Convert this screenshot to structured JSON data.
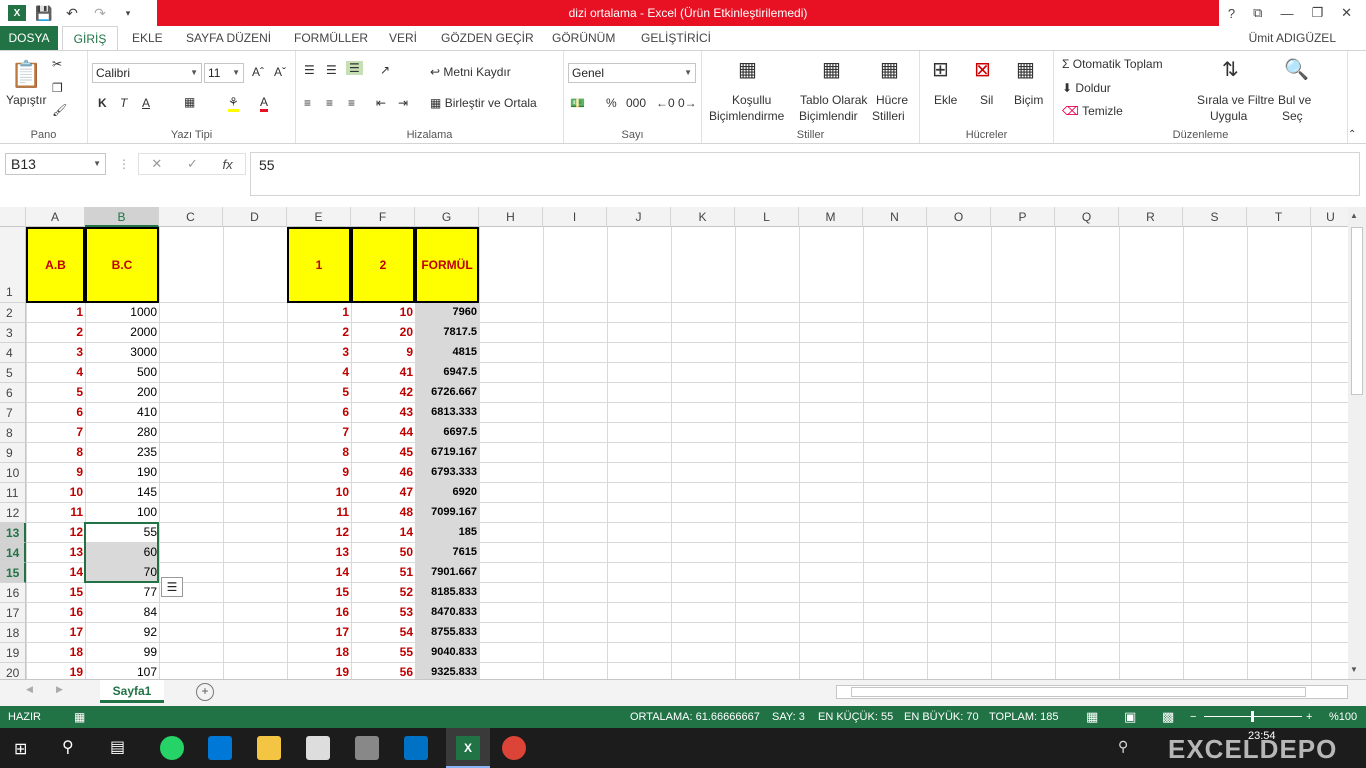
{
  "window": {
    "title": "dizi ortalama -  Excel (Ürün Etkinleştirilemedi)",
    "help": "?",
    "restore": "⧉",
    "minimize": "—",
    "maximize": "❐",
    "close": "✕"
  },
  "tabs": [
    "DOSYA",
    "GİRİŞ",
    "EKLE",
    "SAYFA DÜZENİ",
    "FORMÜLLER",
    "VERİ",
    "GÖZDEN GEÇİR",
    "GÖRÜNÜM",
    "GELİŞTİRİCİ"
  ],
  "user": "Ümit ADIGÜZEL",
  "ribbon": {
    "clipboard": {
      "paste": "Yapıştır",
      "label": "Pano"
    },
    "font": {
      "name": "Calibri",
      "size": "11",
      "label": "Yazı Tipi",
      "bold": "K",
      "italic": "T",
      "underline": "A",
      "color": "A"
    },
    "align": {
      "wrap": "Metni Kaydır",
      "merge": "Birleştir ve Ortala",
      "label": "Hizalama"
    },
    "number": {
      "format": "Genel",
      "percent": "%",
      "comma": "000",
      "label": "Sayı"
    },
    "styles": {
      "cond": "Koşullu",
      "cond2": "Biçimlendirme",
      "table": "Tablo Olarak",
      "table2": "Biçimlendir",
      "cell": "Hücre",
      "cell2": "Stilleri",
      "label": "Stiller"
    },
    "cells": {
      "insert": "Ekle",
      "delete": "Sil",
      "format": "Biçim",
      "label": "Hücreler"
    },
    "editing": {
      "autosum": "Otomatik Toplam",
      "fill": "Doldur",
      "clear": "Temizle",
      "sort": "Sırala ve Filtre",
      "sort2": "Uygula",
      "find": "Bul ve",
      "find2": "Seç",
      "label": "Düzenleme"
    }
  },
  "namebox": "B13",
  "fx": "fx",
  "formula": "55",
  "columns": [
    "A",
    "B",
    "C",
    "D",
    "E",
    "F",
    "G",
    "H",
    "I",
    "J",
    "K",
    "L",
    "M",
    "N",
    "O",
    "P",
    "Q",
    "R",
    "S",
    "T",
    "U"
  ],
  "headers": {
    "a": "A.B",
    "b": "B.C",
    "e": "1",
    "f": "2",
    "g": "FORMÜL"
  },
  "rows": [
    {
      "r": "1"
    },
    {
      "r": "2",
      "a": "1",
      "b": "1000",
      "e": "1",
      "f": "10",
      "g": "7960"
    },
    {
      "r": "3",
      "a": "2",
      "b": "2000",
      "e": "2",
      "f": "20",
      "g": "7817.5"
    },
    {
      "r": "4",
      "a": "3",
      "b": "3000",
      "e": "3",
      "f": "9",
      "g": "4815"
    },
    {
      "r": "5",
      "a": "4",
      "b": "500",
      "e": "4",
      "f": "41",
      "g": "6947.5"
    },
    {
      "r": "6",
      "a": "5",
      "b": "200",
      "e": "5",
      "f": "42",
      "g": "6726.667"
    },
    {
      "r": "7",
      "a": "6",
      "b": "410",
      "e": "6",
      "f": "43",
      "g": "6813.333"
    },
    {
      "r": "8",
      "a": "7",
      "b": "280",
      "e": "7",
      "f": "44",
      "g": "6697.5"
    },
    {
      "r": "9",
      "a": "8",
      "b": "235",
      "e": "8",
      "f": "45",
      "g": "6719.167"
    },
    {
      "r": "10",
      "a": "9",
      "b": "190",
      "e": "9",
      "f": "46",
      "g": "6793.333"
    },
    {
      "r": "11",
      "a": "10",
      "b": "145",
      "e": "10",
      "f": "47",
      "g": "6920"
    },
    {
      "r": "12",
      "a": "11",
      "b": "100",
      "e": "11",
      "f": "48",
      "g": "7099.167"
    },
    {
      "r": "13",
      "a": "12",
      "b": "55",
      "e": "12",
      "f": "14",
      "g": "185"
    },
    {
      "r": "14",
      "a": "13",
      "b": "60",
      "e": "13",
      "f": "50",
      "g": "7615"
    },
    {
      "r": "15",
      "a": "14",
      "b": "70",
      "e": "14",
      "f": "51",
      "g": "7901.667"
    },
    {
      "r": "16",
      "a": "15",
      "b": "77",
      "e": "15",
      "f": "52",
      "g": "8185.833"
    },
    {
      "r": "17",
      "a": "16",
      "b": "84",
      "e": "16",
      "f": "53",
      "g": "8470.833"
    },
    {
      "r": "18",
      "a": "17",
      "b": "92",
      "e": "17",
      "f": "54",
      "g": "8755.833"
    },
    {
      "r": "19",
      "a": "18",
      "b": "99",
      "e": "18",
      "f": "55",
      "g": "9040.833"
    },
    {
      "r": "20",
      "a": "19",
      "b": "107",
      "e": "19",
      "f": "56",
      "g": "9325.833"
    }
  ],
  "sheet": "Sayfa1",
  "status": {
    "mode": "HAZIR",
    "avg": "ORTALAMA: 61.66666667",
    "count": "SAY: 3",
    "min": "EN KÜÇÜK: 55",
    "max": "EN BÜYÜK: 70",
    "sum": "TOPLAM: 185",
    "zoom": "%100"
  },
  "clock": {
    "time": "23:54"
  },
  "watermark": "EXCELDEPO",
  "colors": {
    "excel_green": "#217346",
    "title_red": "#e81123",
    "header_yellow": "#ffff00",
    "text_red": "#c00000"
  }
}
